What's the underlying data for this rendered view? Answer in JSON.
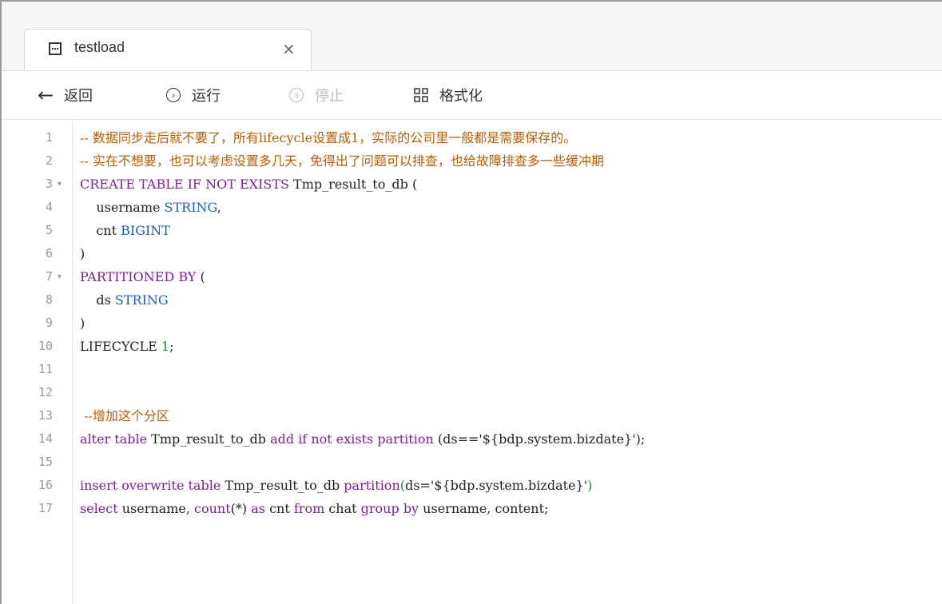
{
  "tab": {
    "title": "testload",
    "close": "×"
  },
  "toolbar": {
    "back": "返回",
    "run": "运行",
    "stop": "停止",
    "format": "格式化"
  },
  "editor": {
    "lines": [
      {
        "n": "1",
        "fold": ""
      },
      {
        "n": "2",
        "fold": ""
      },
      {
        "n": "3",
        "fold": "▾"
      },
      {
        "n": "4",
        "fold": ""
      },
      {
        "n": "5",
        "fold": ""
      },
      {
        "n": "6",
        "fold": ""
      },
      {
        "n": "7",
        "fold": "▾"
      },
      {
        "n": "8",
        "fold": ""
      },
      {
        "n": "9",
        "fold": ""
      },
      {
        "n": "10",
        "fold": ""
      },
      {
        "n": "11",
        "fold": ""
      },
      {
        "n": "12",
        "fold": ""
      },
      {
        "n": "13",
        "fold": ""
      },
      {
        "n": "14",
        "fold": ""
      },
      {
        "n": "15",
        "fold": ""
      },
      {
        "n": "16",
        "fold": ""
      },
      {
        "n": "17",
        "fold": ""
      }
    ],
    "code": {
      "l1": "-- 数据同步走后就不要了，所有lifecycle设置成1，实际的公司里一般都是需要保存的。",
      "l2": "-- 实在不想要，也可以考虑设置多几天，免得出了问题可以排查，也给故障排查多一些缓冲期",
      "l3_kw": "CREATE TABLE IF NOT EXISTS",
      "l3_rest": " Tmp_result_to_db (",
      "l4_name": "    username ",
      "l4_type": "STRING",
      "l4_end": ",",
      "l5_name": "    cnt ",
      "l5_type": "BIGINT",
      "l6": ")",
      "l7_kw": "PARTITIONED BY",
      "l7_rest": " (",
      "l8_name": "    ds ",
      "l8_type": "STRING",
      "l9": ")",
      "l10_kw": "LIFECYCLE ",
      "l10_num": "1",
      "l10_end": ";",
      "l13": " --增加这个分区",
      "l14_a": "alter table",
      "l14_b": " Tmp_result_to_db ",
      "l14_c": "add if not exists partition",
      "l14_d": " (ds=='${bdp.system.bizdate}');",
      "l16_a": "insert overwrite table",
      "l16_b": " Tmp_result_to_db ",
      "l16_c": "partition",
      "l16_d": "(",
      "l16_e": "ds='${bdp.system.bizdate}'",
      "l16_f": ")",
      "l17_a": "select",
      "l17_b": " username, ",
      "l17_c": "count",
      "l17_d": "(*) ",
      "l17_e": "as",
      "l17_f": " cnt ",
      "l17_g": "from",
      "l17_h": " chat ",
      "l17_i": "group by",
      "l17_j": " username, content;"
    }
  }
}
